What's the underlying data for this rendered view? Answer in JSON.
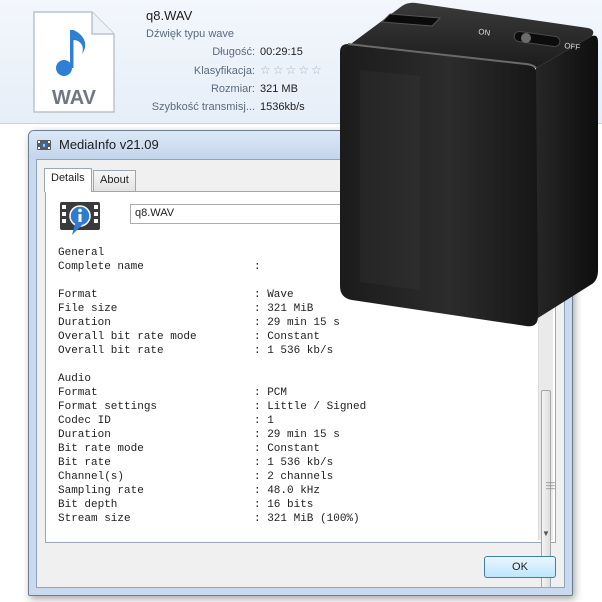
{
  "explorer": {
    "file_name": "q8.WAV",
    "file_type": "Dźwięk typu wave",
    "icon_label": "WAV",
    "properties": [
      {
        "label": "Długość:",
        "value": "00:29:15"
      },
      {
        "label": "Klasyfikacja:",
        "value": "☆☆☆☆☆"
      },
      {
        "label": "Rozmiar:",
        "value": "321 MB"
      },
      {
        "label": "Szybkość transmisj...",
        "value": "1536kb/s"
      }
    ]
  },
  "window": {
    "title": "MediaInfo v21.09",
    "tabs": [
      {
        "label": "Details",
        "active": true
      },
      {
        "label": "About",
        "active": false
      }
    ],
    "file_field_value": "q8.WAV",
    "report_lines": [
      {
        "key": "General",
        "value": ""
      },
      {
        "key": "Complete name",
        "value": ":"
      },
      {
        "key": "",
        "value": ""
      },
      {
        "key": "Format",
        "value": ": Wave"
      },
      {
        "key": "File size",
        "value": ": 321 MiB"
      },
      {
        "key": "Duration",
        "value": ": 29 min 15 s"
      },
      {
        "key": "Overall bit rate mode",
        "value": ": Constant"
      },
      {
        "key": "Overall bit rate",
        "value": ": 1 536 kb/s"
      },
      {
        "key": "",
        "value": ""
      },
      {
        "key": "Audio",
        "value": ""
      },
      {
        "key": "Format",
        "value": ": PCM"
      },
      {
        "key": "Format settings",
        "value": ": Little / Signed"
      },
      {
        "key": "Codec ID",
        "value": ": 1"
      },
      {
        "key": "Duration",
        "value": ": 29 min 15 s"
      },
      {
        "key": "Bit rate mode",
        "value": ": Constant"
      },
      {
        "key": "Bit rate",
        "value": ": 1 536 kb/s"
      },
      {
        "key": "Channel(s)",
        "value": ": 2 channels"
      },
      {
        "key": "Sampling rate",
        "value": ": 48.0 kHz"
      },
      {
        "key": "Bit depth",
        "value": ": 16 bits"
      },
      {
        "key": "Stream size",
        "value": ": 321 MiB (100%)"
      }
    ],
    "ok_label": "OK"
  },
  "device": {
    "switch_on_label": "ON",
    "switch_off_label": "OFF"
  },
  "colors": {
    "explorer_bg": "#eaf1f9",
    "window_frame": "#c9daee",
    "device_body": "#1e1e1e",
    "ok_border": "#3c7fb1"
  }
}
